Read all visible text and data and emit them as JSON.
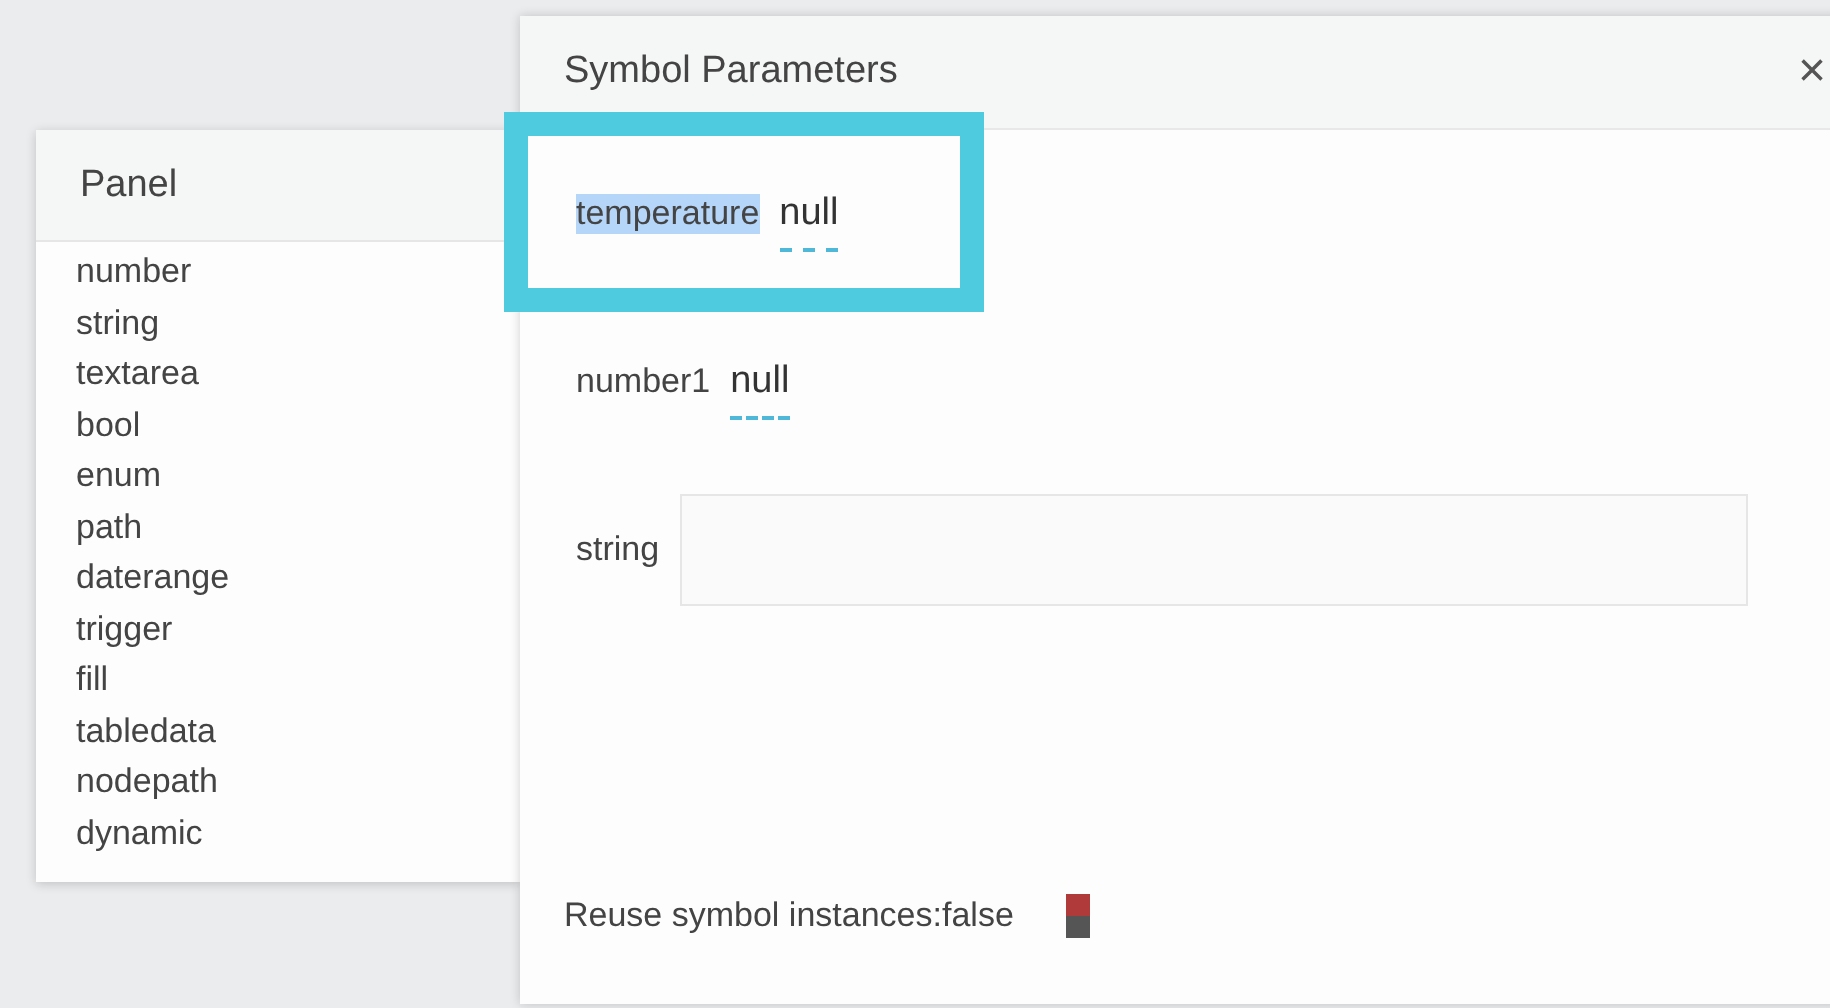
{
  "panel": {
    "title": "Panel",
    "items": [
      "number",
      "string",
      "textarea",
      "bool",
      "enum",
      "path",
      "daterange",
      "trigger",
      "fill",
      "tabledata",
      "nodepath",
      "dynamic"
    ]
  },
  "dialog": {
    "title": "Symbol Parameters",
    "close": "×",
    "params": [
      {
        "kind": "editable",
        "label": "temperature",
        "label_selected": true,
        "highlighted": true,
        "value": "null"
      },
      {
        "kind": "editable",
        "label": "number1",
        "label_selected": false,
        "highlighted": false,
        "value": "null"
      },
      {
        "kind": "text",
        "label": "string",
        "label_selected": false,
        "highlighted": false
      }
    ],
    "reuse": {
      "label": "Reuse symbol instances:",
      "value": "false",
      "on": false
    }
  }
}
